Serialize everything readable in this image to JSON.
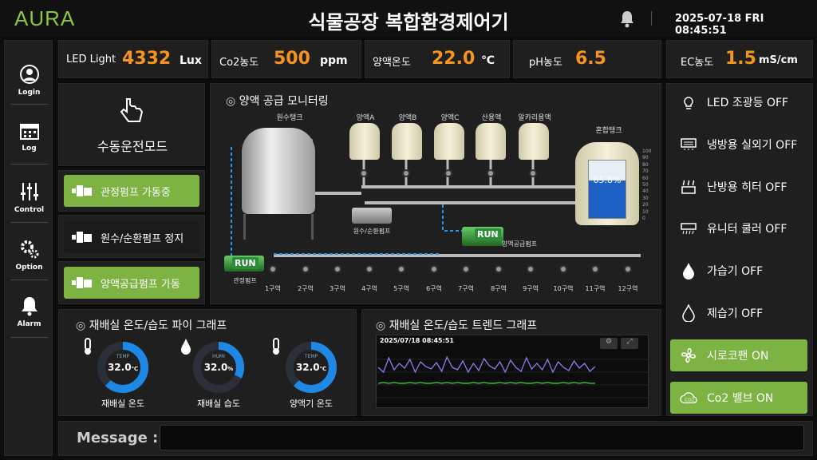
{
  "header": {
    "logo": "AURA",
    "title": "식물공장 복합환경제어기",
    "datetime": "2025-07-18 FRI 08:45:51"
  },
  "sidebar": {
    "items": [
      {
        "label": "Login",
        "icon": "user-icon"
      },
      {
        "label": "Log",
        "icon": "calendar-icon"
      },
      {
        "label": "Control",
        "icon": "sliders-icon"
      },
      {
        "label": "Option",
        "icon": "gears-icon"
      },
      {
        "label": "Alarm",
        "icon": "bell-icon"
      }
    ]
  },
  "metrics": [
    {
      "label": "LED Light",
      "value": "4332",
      "unit": "Lux"
    },
    {
      "label": "Co2농도",
      "value": "500",
      "unit": "ppm"
    },
    {
      "label": "양액온도",
      "value": "22.0",
      "unit": "℃"
    },
    {
      "label": "pH농도",
      "value": "6.5",
      "unit": ""
    },
    {
      "label": "EC농도",
      "value": "1.5",
      "unit": "mS/cm"
    }
  ],
  "mode": {
    "label": "수동운전모드"
  },
  "pumps": [
    {
      "label": "관정펌프 가동중",
      "state": "on"
    },
    {
      "label": "원수/순환펌프 정지",
      "state": "off"
    },
    {
      "label": "양액공급펌프 가동",
      "state": "on"
    }
  ],
  "monitor": {
    "title": "양액 공급 모니터링",
    "raw_tank": "원수탱크",
    "mix_tank": "혼합탱크",
    "mix_level": "65.8%",
    "mix_level_value": 65.8,
    "scale": [
      "100",
      "90",
      "80",
      "70",
      "60",
      "50",
      "40",
      "30",
      "20",
      "10",
      "0"
    ],
    "tanks": [
      "양액A",
      "양액B",
      "양액C",
      "산용액",
      "알카리용액"
    ],
    "well_pump": "관정펌프",
    "circ_pump": "원수/순환펌프",
    "supply_pump": "양액공급펌프",
    "run_label": "RUN",
    "zones": [
      "1구역",
      "2구역",
      "3구역",
      "4구역",
      "5구역",
      "6구역",
      "7구역",
      "8구역",
      "9구역",
      "10구역",
      "11구역",
      "12구역"
    ]
  },
  "pie": {
    "title": "재배실 온도/습도 파이 그래프",
    "gauges": [
      {
        "tag": "TEMP",
        "value": "32.0",
        "unit": "℃",
        "label": "재배실 온도",
        "fill": 0.62
      },
      {
        "tag": "HUMI",
        "value": "32.0",
        "unit": "%",
        "label": "재배실 습도",
        "fill": 0.32
      },
      {
        "tag": "TEMP",
        "value": "32.0",
        "unit": "℃",
        "label": "양액기 온도",
        "fill": 0.62
      }
    ]
  },
  "trend": {
    "title": "재배실 온도/습도 트렌드 그래프",
    "timestamp": "2025/07/18 08:45:51",
    "temp": [
      50,
      44,
      62,
      47,
      55,
      49,
      60,
      44,
      57,
      51,
      48,
      56,
      45,
      63,
      50,
      47,
      58,
      44,
      55,
      46,
      61,
      52,
      48,
      57,
      44,
      59,
      50,
      45,
      62,
      48,
      55,
      47,
      60,
      44,
      57,
      50,
      46,
      58,
      49,
      55,
      45,
      51
    ],
    "humi": [
      30,
      31,
      30,
      31,
      30,
      30,
      31,
      30,
      31,
      30,
      30,
      31,
      30,
      31,
      30,
      31,
      30,
      30,
      31,
      30,
      31,
      30,
      30,
      31,
      30,
      31,
      30,
      31,
      30,
      30,
      31,
      30,
      31,
      30,
      30,
      31,
      30,
      31,
      30,
      31,
      30,
      30
    ]
  },
  "controls": [
    {
      "label": "LED 조광등  OFF",
      "icon": "bulb-icon",
      "state": "off"
    },
    {
      "label": "냉방용 실외기 OFF",
      "icon": "ac-unit-icon",
      "state": "off"
    },
    {
      "label": "난방용 히터 OFF",
      "icon": "heater-icon",
      "state": "off"
    },
    {
      "label": "유니터 쿨러 OFF",
      "icon": "cooler-icon",
      "state": "off"
    },
    {
      "label": "가습기 OFF",
      "icon": "humidifier-icon",
      "state": "off"
    },
    {
      "label": "제습기 OFF",
      "icon": "dehumidifier-icon",
      "state": "off"
    },
    {
      "label": "시로코팬 ON",
      "icon": "fan-icon",
      "state": "on"
    },
    {
      "label": "Co2 밸브 ON",
      "icon": "co2-icon",
      "state": "on"
    }
  ],
  "message": {
    "label": "Message :",
    "value": ""
  },
  "colors": {
    "accent": "#f7941d",
    "green": "#7cb342",
    "blue": "#1e88e5",
    "logo": "#8dc63f"
  }
}
